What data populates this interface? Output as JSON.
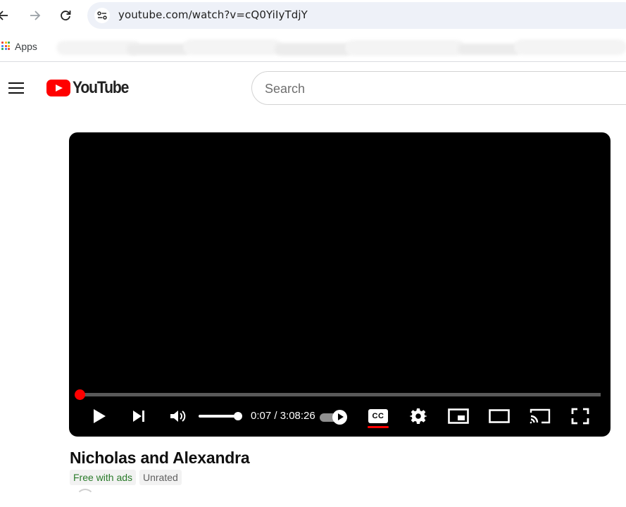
{
  "browser": {
    "url": "youtube.com/watch?v=cQ0YiIyTdjY",
    "bookmarks": {
      "apps_label": "Apps"
    },
    "apps_icon_colors": [
      "#ea4335",
      "#fbbc04",
      "#34a853",
      "#4285f4",
      "#ea4335",
      "#fbbc04",
      "#34a853",
      "#4285f4",
      "#ea4335"
    ]
  },
  "icons": {
    "back": "back-arrow-icon",
    "forward": "forward-arrow-icon",
    "reload": "reload-icon",
    "site_info": "site-settings-icon",
    "menu": "hamburger-menu-icon",
    "logo": "youtube-logo-icon",
    "play": "play-icon",
    "next": "skip-next-icon",
    "volume": "volume-icon",
    "settings": "gear-icon",
    "miniplayer": "miniplayer-icon",
    "theater": "theater-mode-icon",
    "cast": "cast-icon",
    "fullscreen": "fullscreen-icon"
  },
  "youtube": {
    "logo_text": "YouTube",
    "brand_color": "#ff0000",
    "search": {
      "placeholder": "Search"
    },
    "player": {
      "current_time": "0:07",
      "duration": "3:08:26",
      "time_display": "0:07 / 3:08:26",
      "progress_fraction": 0.0006,
      "volume_fraction": 1.0,
      "autoplay_on": true,
      "captions_label": "CC",
      "captions_on": true
    },
    "video": {
      "title": "Nicholas and Alexandra",
      "badges": [
        "Free with ads",
        "Unrated"
      ]
    }
  }
}
